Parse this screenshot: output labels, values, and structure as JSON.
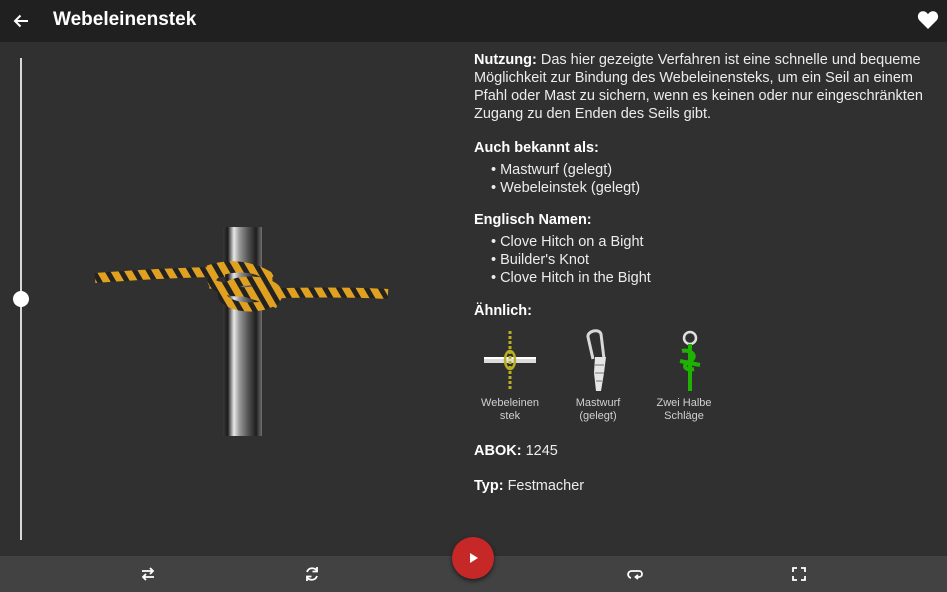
{
  "header": {
    "title": "Webeleinenstek"
  },
  "info": {
    "usage_label": "Nutzung:",
    "usage_text": "Das hier gezeigte Verfahren ist eine schnelle und bequeme Möglichkeit zur Bindung des Webeleinensteks, um ein Seil an einem Pfahl oder Mast zu sichern, wenn es keinen oder nur eingeschränkten Zugang zu den Enden des Seils gibt.",
    "aka_label": "Auch bekannt als:",
    "aka_items": [
      "Mastwurf (gelegt)",
      "Webeleinstek (gelegt)"
    ],
    "english_label": "Englisch Namen:",
    "english_items": [
      "Clove Hitch on a Bight",
      "Builder's Knot",
      "Clove Hitch in the Bight"
    ],
    "similar_label": "Ähnlich:",
    "similar": [
      {
        "caption_line1": "Webeleinen",
        "caption_line2": "stek"
      },
      {
        "caption_line1": "Mastwurf",
        "caption_line2": "(gelegt)"
      },
      {
        "caption_line1": "Zwei Halbe",
        "caption_line2": "Schläge"
      }
    ],
    "abok_label": "ABOK:",
    "abok_value": "1245",
    "type_label": "Typ:",
    "type_value": "Festmacher"
  },
  "slider": {
    "value_fraction": 0.5
  },
  "icons": {
    "back": "arrow-left-icon",
    "favorite": "heart-icon",
    "bottom": [
      "swap-horizontal-icon",
      "rotate-icon",
      "repeat-icon",
      "fullscreen-icon"
    ],
    "play": "play-icon"
  },
  "colors": {
    "topbar": "#202020",
    "background": "#303030",
    "bottombar": "#424242",
    "play_button": "#c62828",
    "rope_primary": "#e0a020",
    "rope_secondary": "#222222",
    "similar_rope_green": "#1db300"
  }
}
